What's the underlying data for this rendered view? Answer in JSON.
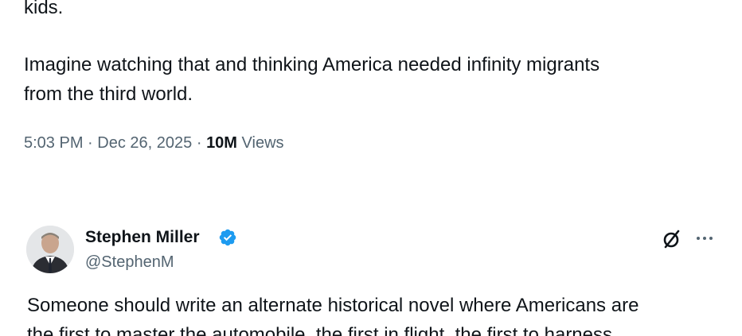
{
  "first_tweet": {
    "lines": [
      "kids.",
      "Imagine watching that and thinking America needed infinity migrants",
      "from the third world."
    ],
    "meta": {
      "time": "5:03 PM",
      "separator": "·",
      "date": "Dec 26, 2025",
      "views_count": "10M",
      "views_label": "Views"
    }
  },
  "second_tweet": {
    "author": {
      "name": "Stephen Miller",
      "handle": "@StephenM",
      "verified": true,
      "verified_color": "#1d9bf0"
    },
    "actions": {
      "grok_icon": "grok-icon",
      "more_icon": "more-icon"
    },
    "lines": [
      "Someone should write an alternate historical novel where Americans are",
      "the first to master the automobile, the first in flight, the first to harness"
    ]
  },
  "colors": {
    "text_primary": "#0f1419",
    "text_secondary": "#536471",
    "accent": "#1d9bf0"
  }
}
